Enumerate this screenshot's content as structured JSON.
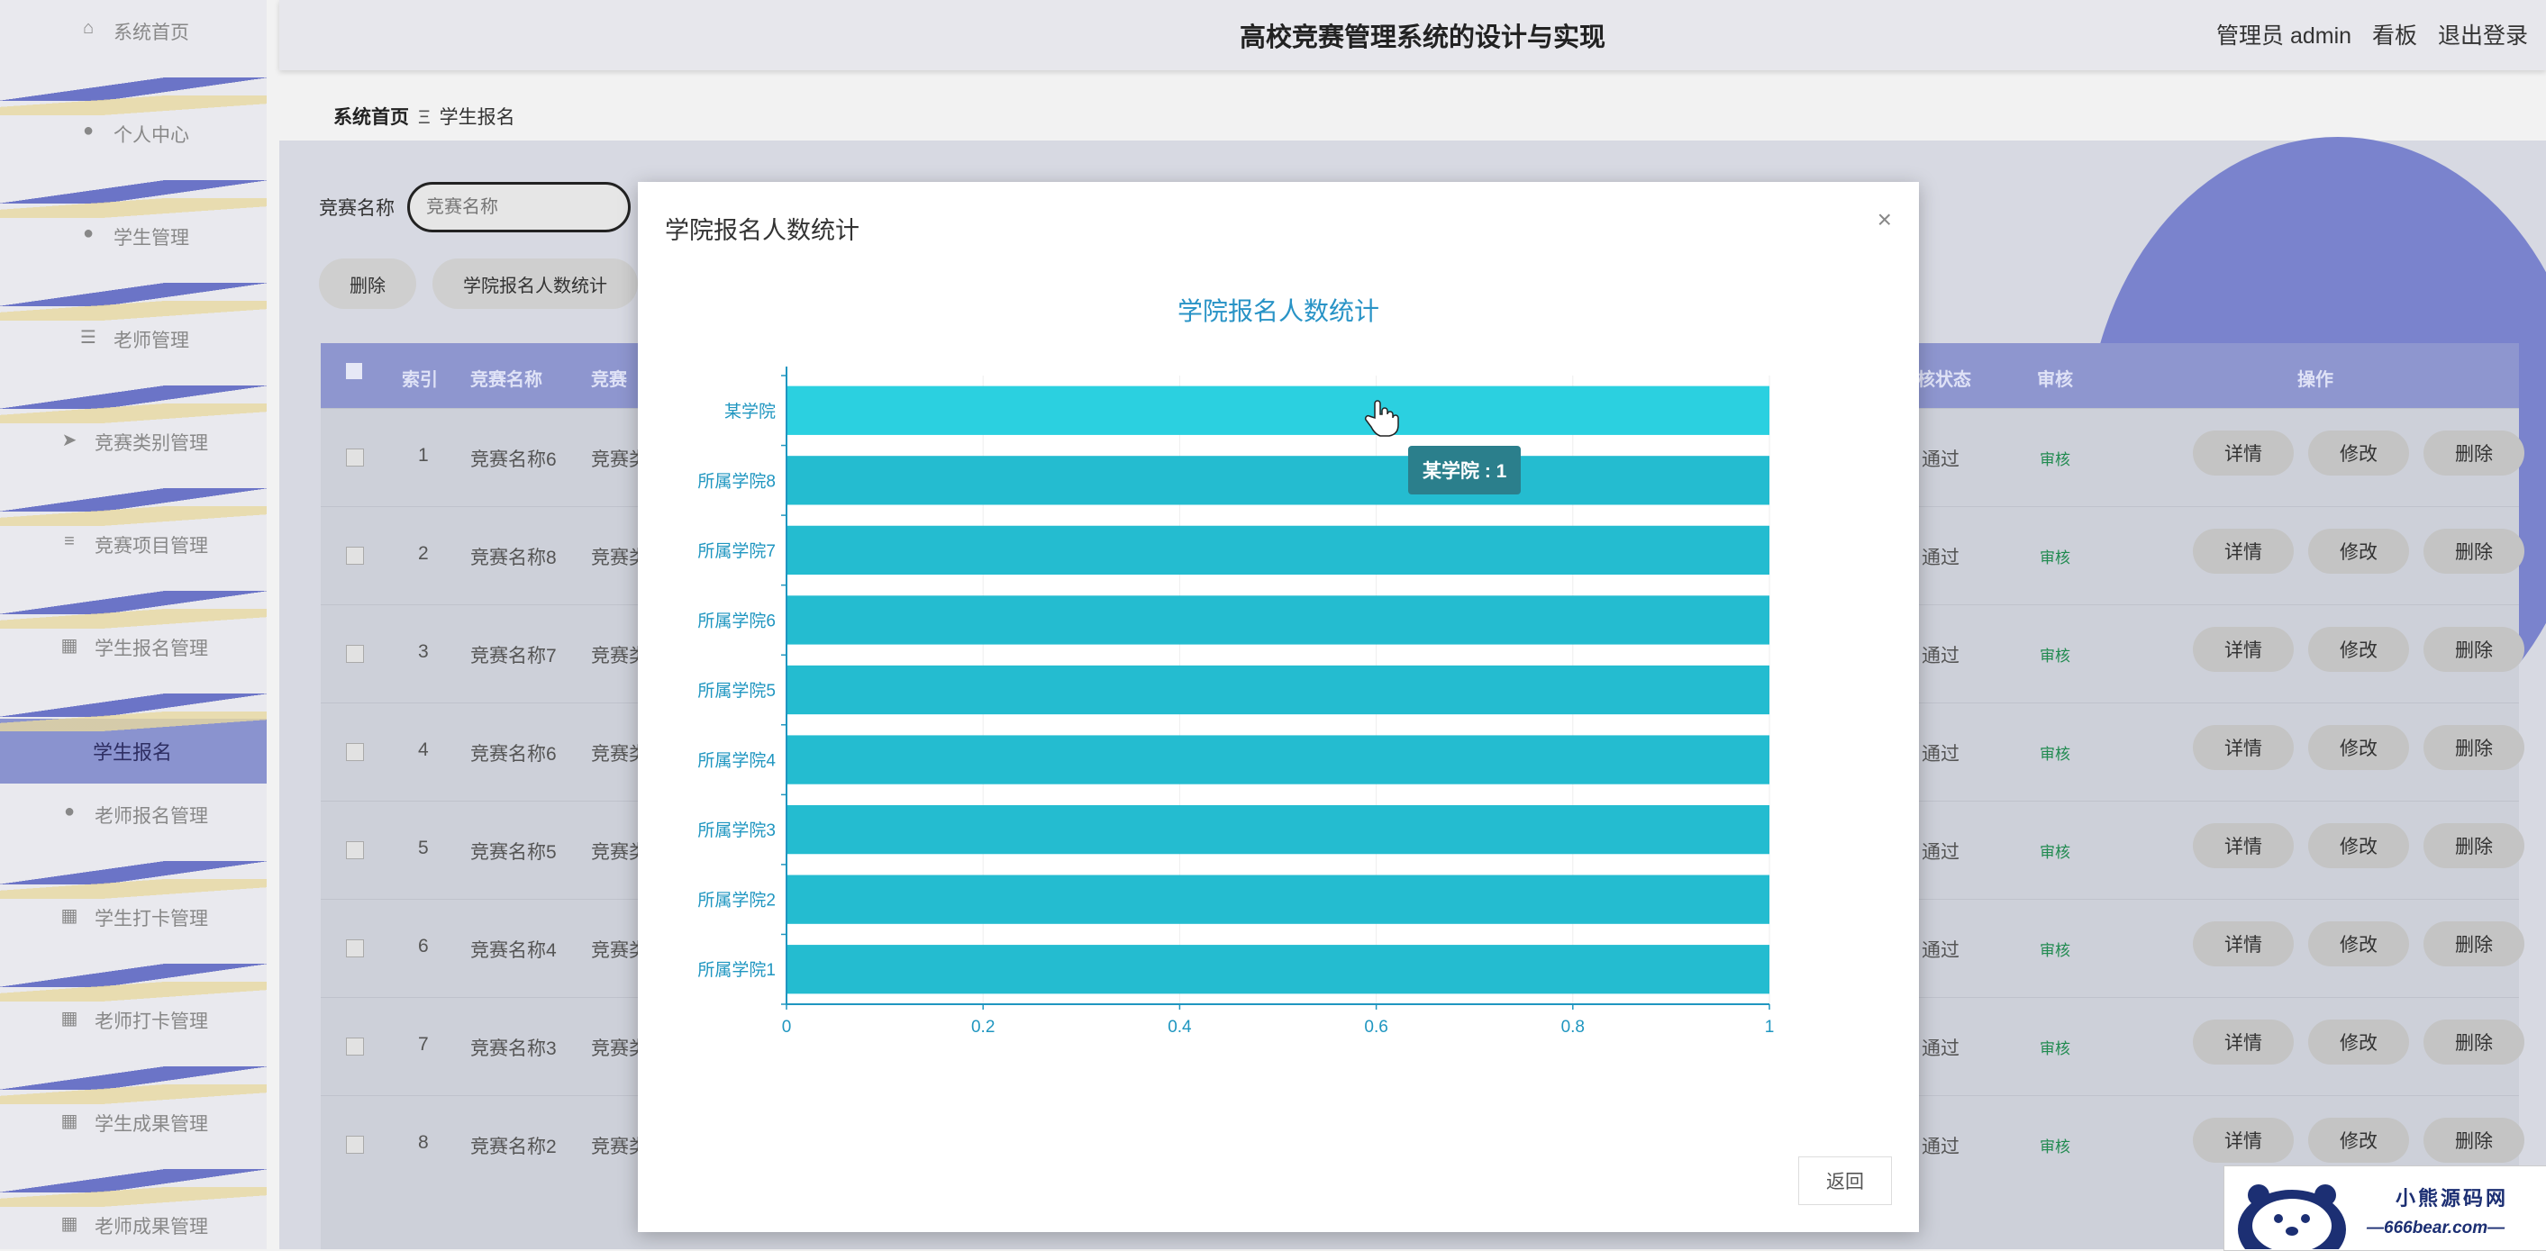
{
  "sidebar": {
    "items": [
      {
        "label": "系统首页",
        "icon": "home-icon"
      },
      {
        "label": "个人中心",
        "icon": "user-icon"
      },
      {
        "label": "学生管理",
        "icon": "user-icon"
      },
      {
        "label": "老师管理",
        "icon": "list-icon"
      },
      {
        "label": "竞赛类别管理",
        "icon": "send-icon"
      },
      {
        "label": "竞赛项目管理",
        "icon": "sliders-icon"
      },
      {
        "label": "学生报名管理",
        "icon": "grid-icon"
      },
      {
        "label": "老师报名管理",
        "icon": "user-icon"
      },
      {
        "label": "学生打卡管理",
        "icon": "grid-icon"
      },
      {
        "label": "老师打卡管理",
        "icon": "grid-icon"
      },
      {
        "label": "学生成果管理",
        "icon": "grid-icon"
      },
      {
        "label": "老师成果管理",
        "icon": "grid-icon"
      }
    ],
    "active_sub": "学生报名"
  },
  "header": {
    "title": "高校竞赛管理系统的设计与实现",
    "admin": "管理员 admin",
    "board": "看板",
    "logout": "退出登录"
  },
  "breadcrumb": {
    "home": "系统首页",
    "sep": "Ξ",
    "current": "学生报名"
  },
  "search": {
    "label": "竞赛名称",
    "placeholder": "竞赛名称"
  },
  "toolbar": {
    "delete_label": "删除",
    "stats_label": "学院报名人数统计"
  },
  "table": {
    "headers": {
      "index": "索引",
      "name": "竞赛名称",
      "category": "竞赛",
      "status": "核状态",
      "audit": "审核",
      "ops": "操作"
    },
    "rows": [
      {
        "idx": "1",
        "name": "竞赛名称6",
        "cat": "竞赛类",
        "status": "通过",
        "audit": "审核"
      },
      {
        "idx": "2",
        "name": "竞赛名称8",
        "cat": "竞赛类",
        "status": "通过",
        "audit": "审核"
      },
      {
        "idx": "3",
        "name": "竞赛名称7",
        "cat": "竞赛类",
        "status": "通过",
        "audit": "审核"
      },
      {
        "idx": "4",
        "name": "竞赛名称6",
        "cat": "竞赛类",
        "status": "通过",
        "audit": "审核"
      },
      {
        "idx": "5",
        "name": "竞赛名称5",
        "cat": "竞赛类",
        "status": "通过",
        "audit": "审核"
      },
      {
        "idx": "6",
        "name": "竞赛名称4",
        "cat": "竞赛类",
        "status": "通过",
        "audit": "审核"
      },
      {
        "idx": "7",
        "name": "竞赛名称3",
        "cat": "竞赛类",
        "status": "通过",
        "audit": "审核"
      },
      {
        "idx": "8",
        "name": "竞赛名称2",
        "cat": "竞赛类",
        "status": "通过",
        "audit": "审核"
      }
    ],
    "ops": {
      "detail": "详情",
      "edit": "修改",
      "delete": "删除"
    }
  },
  "modal": {
    "title": "学院报名人数统计",
    "close": "×",
    "back_label": "返回",
    "tooltip": "某学院 : 1"
  },
  "chart_data": {
    "type": "bar",
    "orientation": "horizontal",
    "title": "学院报名人数统计",
    "categories": [
      "某学院",
      "所属学院8",
      "所属学院7",
      "所属学院6",
      "所属学院5",
      "所属学院4",
      "所属学院3",
      "所属学院2",
      "所属学院1"
    ],
    "values": [
      1,
      1,
      1,
      1,
      1,
      1,
      1,
      1,
      1
    ],
    "xlim": [
      0,
      1
    ],
    "xticks": [
      "0",
      "0.2",
      "0.4",
      "0.6",
      "0.8",
      "1"
    ],
    "highlighted": "某学院",
    "colors": {
      "bar": "#24bcd0",
      "bar_highlight": "#2bd0e0",
      "axis": "#1f96c0",
      "title": "#2893c6"
    }
  },
  "watermark": {
    "line1": "小熊源码网",
    "line2": "—666bear.com—"
  }
}
